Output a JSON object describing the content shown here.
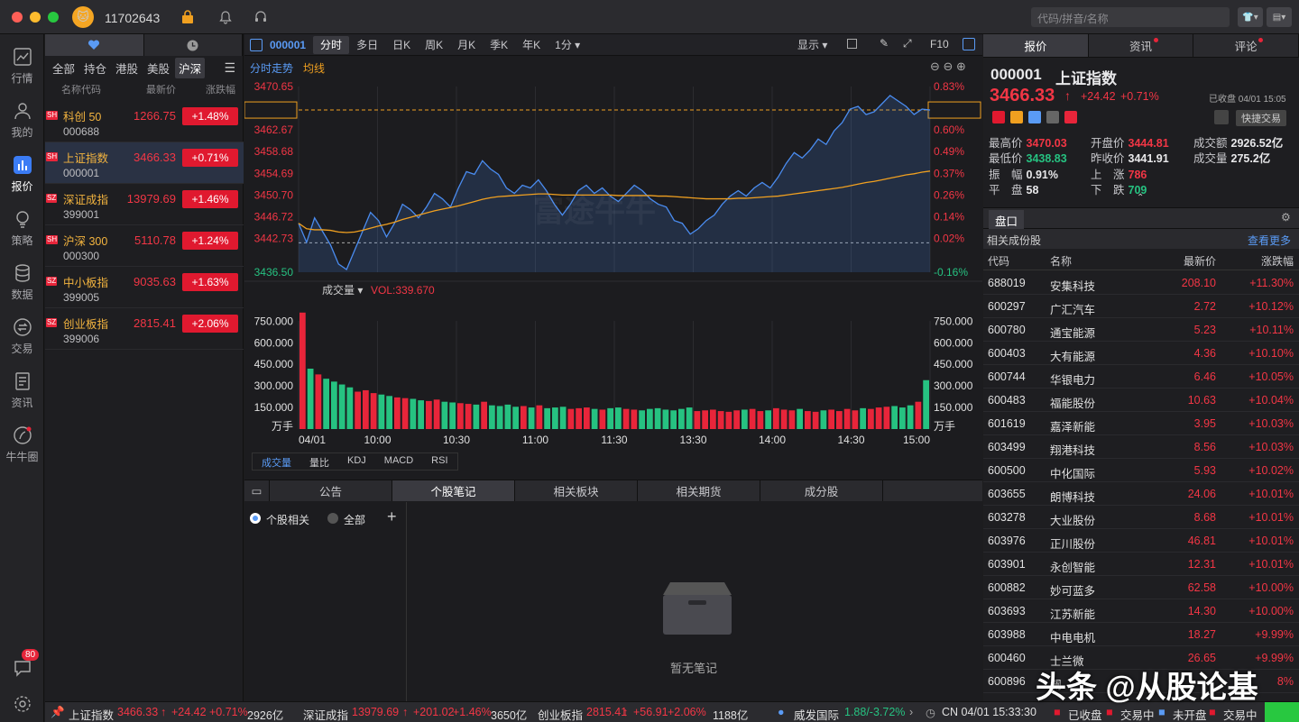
{
  "titlebar": {
    "user_id": "11702643",
    "search_placeholder": "代码/拼音/名称",
    "traffic_colors": [
      "#fe5f57",
      "#febc2e",
      "#28c840"
    ]
  },
  "sidebar": {
    "items": [
      {
        "label": "行情",
        "icon": "trend-chart-icon"
      },
      {
        "label": "我的",
        "icon": "user-icon"
      },
      {
        "label": "报价",
        "icon": "bar-chart-icon",
        "active": true
      },
      {
        "label": "策略",
        "icon": "bulb-icon"
      },
      {
        "label": "数据",
        "icon": "database-icon"
      },
      {
        "label": "交易",
        "icon": "exchange-icon"
      },
      {
        "label": "资讯",
        "icon": "document-icon"
      },
      {
        "label": "牛牛圈",
        "icon": "circle-icon"
      }
    ],
    "message_count": "80"
  },
  "watchlist": {
    "filters": [
      "全部",
      "持仓",
      "港股",
      "美股",
      "沪深"
    ],
    "active_filter": "沪深",
    "headers": {
      "name": "名称代码",
      "price": "最新价",
      "change": "涨跌幅"
    },
    "rows": [
      {
        "market": "SH",
        "name": "科创 50",
        "code": "000688",
        "price": "1266.75",
        "change": "+1.48%"
      },
      {
        "market": "SH",
        "name": "上证指数",
        "code": "000001",
        "price": "3466.33",
        "change": "+0.71%"
      },
      {
        "market": "SZ",
        "name": "深证成指",
        "code": "399001",
        "price": "13979.69",
        "change": "+1.46%"
      },
      {
        "market": "SH",
        "name": "沪深 300",
        "code": "000300",
        "price": "5110.78",
        "change": "+1.24%"
      },
      {
        "market": "SZ",
        "name": "中小板指",
        "code": "399005",
        "price": "9035.63",
        "change": "+1.63%"
      },
      {
        "market": "SZ",
        "name": "创业板指",
        "code": "399006",
        "price": "2815.41",
        "change": "+2.06%"
      }
    ]
  },
  "chart_toolbar": {
    "code": "000001",
    "periods": [
      "分时",
      "多日",
      "日K",
      "周K",
      "月K",
      "季K",
      "年K",
      "1分"
    ],
    "active_period": "分时",
    "display_label": "显示",
    "f10_label": "F10"
  },
  "chart_sub": {
    "trend_label": "分时走势",
    "avg_label": "均线",
    "watermark": "富途牛牛"
  },
  "volume_bar": {
    "label": "成交量",
    "value": "VOL:339.670"
  },
  "indicator_tabs": [
    "成交量",
    "量比",
    "KDJ",
    "MACD",
    "RSI"
  ],
  "bottom_tabs": [
    "公告",
    "个股笔记",
    "相关板块",
    "相关期货",
    "成分股"
  ],
  "active_bottom_tab": "个股笔记",
  "notes": {
    "radio_related": "个股相关",
    "radio_all": "全部",
    "empty_text": "暂无笔记"
  },
  "chart_data": [
    {
      "type": "line",
      "title": "分时走势",
      "x_ticks": [
        "04/01",
        "10:00",
        "10:30",
        "11:00",
        "11:30",
        "13:30",
        "14:00",
        "14:30",
        "15:00"
      ],
      "y_ticks_left": [
        "3470.65",
        "3466.33",
        "3462.67",
        "3458.68",
        "3454.69",
        "3450.70",
        "3446.72",
        "3442.73",
        "3436.50"
      ],
      "y_ticks_right": [
        "0.83%",
        "0.71%",
        "0.60%",
        "0.49%",
        "0.37%",
        "0.26%",
        "0.14%",
        "0.02%",
        "-0.16%"
      ],
      "ylim": [
        3436.5,
        3470.65
      ],
      "prev_close": 3441.91,
      "series": [
        {
          "name": "价格",
          "color": "#4a8cf0",
          "values": [
            3445.5,
            3442.0,
            3446.5,
            3444.0,
            3441.5,
            3438.0,
            3437.0,
            3440.5,
            3444.0,
            3447.5,
            3446.0,
            3443.0,
            3445.5,
            3449.0,
            3448.0,
            3446.5,
            3448.5,
            3451.0,
            3450.0,
            3448.5,
            3452.0,
            3455.0,
            3454.5,
            3457.0,
            3455.5,
            3454.5,
            3452.0,
            3451.0,
            3452.5,
            3452.0,
            3453.5,
            3451.5,
            3449.0,
            3447.0,
            3449.0,
            3451.5,
            3452.5,
            3451.0,
            3452.0,
            3450.5,
            3449.5,
            3451.0,
            3452.5,
            3451.5,
            3450.0,
            3449.0,
            3448.5,
            3446.0,
            3445.5,
            3443.5,
            3444.5,
            3446.0,
            3447.0,
            3449.0,
            3450.5,
            3451.5,
            3450.5,
            3452.0,
            3453.0,
            3452.0,
            3454.0,
            3456.5,
            3458.5,
            3457.5,
            3459.0,
            3461.0,
            3460.0,
            3462.5,
            3464.0,
            3466.5,
            3467.0,
            3465.5,
            3466.0,
            3467.5,
            3469.0,
            3468.0,
            3467.0,
            3465.5,
            3466.5,
            3466.33
          ]
        },
        {
          "name": "均线",
          "color": "#f0a020",
          "values": [
            3445.5,
            3444.5,
            3444.3,
            3444.3,
            3444.2,
            3443.9,
            3443.8,
            3443.9,
            3444.2,
            3444.6,
            3445.0,
            3445.3,
            3445.7,
            3446.2,
            3446.6,
            3447.0,
            3447.4,
            3447.8,
            3448.1,
            3448.4,
            3448.7,
            3449.1,
            3449.5,
            3449.9,
            3450.2,
            3450.4,
            3450.5,
            3450.6,
            3450.7,
            3450.8,
            3450.9,
            3450.9,
            3450.8,
            3450.7,
            3450.7,
            3450.7,
            3450.7,
            3450.7,
            3450.7,
            3450.7,
            3450.6,
            3450.6,
            3450.6,
            3450.6,
            3450.6,
            3450.5,
            3450.5,
            3450.4,
            3450.3,
            3450.2,
            3450.1,
            3450.0,
            3450.0,
            3450.0,
            3450.0,
            3450.1,
            3450.1,
            3450.2,
            3450.3,
            3450.4,
            3450.5,
            3450.7,
            3450.9,
            3451.1,
            3451.3,
            3451.5,
            3451.7,
            3451.9,
            3452.1,
            3452.4,
            3452.7,
            3453.0,
            3453.2,
            3453.5,
            3453.8,
            3454.1,
            3454.4,
            3454.6,
            3454.9,
            3455.1
          ]
        }
      ]
    },
    {
      "type": "bar",
      "title": "成交量",
      "ylabel": "万手",
      "y_ticks": [
        "750.000",
        "600.000",
        "450.000",
        "300.000",
        "150.000"
      ],
      "ylim": [
        0,
        840
      ],
      "values": [
        810,
        420,
        380,
        350,
        330,
        310,
        290,
        260,
        270,
        250,
        240,
        230,
        220,
        215,
        210,
        200,
        195,
        205,
        190,
        185,
        180,
        175,
        170,
        190,
        165,
        160,
        170,
        155,
        160,
        150,
        165,
        145,
        150,
        155,
        140,
        145,
        150,
        140,
        135,
        145,
        150,
        140,
        135,
        130,
        140,
        145,
        135,
        130,
        140,
        150,
        125,
        130,
        135,
        125,
        120,
        130,
        135,
        140,
        125,
        130,
        145,
        135,
        130,
        140,
        125,
        120,
        130,
        135,
        125,
        140,
        130,
        145,
        140,
        150,
        155,
        160,
        150,
        165,
        190,
        340
      ],
      "colors_up_down": [
        "#e8253a",
        "#26c281"
      ]
    }
  ],
  "quote": {
    "tabs": [
      "报价",
      "资讯",
      "评论"
    ],
    "code": "000001",
    "name": "上证指数",
    "price": "3466.33",
    "change": "+24.42",
    "change_pct": "+0.71%",
    "status": "已收盘 04/01 15:05",
    "quick_trade": "快捷交易",
    "stats": {
      "high_label": "最高价",
      "high": "3470.03",
      "open_label": "开盘价",
      "open": "3444.81",
      "turnover_label": "成交额",
      "turnover": "2926.52亿",
      "low_label": "最低价",
      "low": "3438.83",
      "prev_label": "昨收价",
      "prev": "3441.91",
      "volume_label": "成交量",
      "volume": "275.2亿",
      "amp_label": "振　幅",
      "amp": "0.91%",
      "up_label": "上　涨",
      "up": "786",
      "flat_label": "平　盘",
      "flat": "58",
      "down_label": "下　跌",
      "down": "709"
    },
    "panel_label": "盘口",
    "related_label": "相关成份股",
    "more_label": "查看更多",
    "table_headers": {
      "code": "代码",
      "name": "名称",
      "price": "最新价",
      "change": "涨跌幅"
    },
    "components": [
      {
        "code": "688019",
        "name": "安集科技",
        "price": "208.10",
        "change": "+11.30%"
      },
      {
        "code": "600297",
        "name": "广汇汽车",
        "price": "2.72",
        "change": "+10.12%"
      },
      {
        "code": "600780",
        "name": "通宝能源",
        "price": "5.23",
        "change": "+10.11%"
      },
      {
        "code": "600403",
        "name": "大有能源",
        "price": "4.36",
        "change": "+10.10%"
      },
      {
        "code": "600744",
        "name": "华银电力",
        "price": "6.46",
        "change": "+10.05%"
      },
      {
        "code": "600483",
        "name": "福能股份",
        "price": "10.63",
        "change": "+10.04%"
      },
      {
        "code": "601619",
        "name": "嘉泽新能",
        "price": "3.95",
        "change": "+10.03%"
      },
      {
        "code": "603499",
        "name": "翔港科技",
        "price": "8.56",
        "change": "+10.03%"
      },
      {
        "code": "600500",
        "name": "中化国际",
        "price": "5.93",
        "change": "+10.02%"
      },
      {
        "code": "603655",
        "name": "朗博科技",
        "price": "24.06",
        "change": "+10.01%"
      },
      {
        "code": "603278",
        "name": "大业股份",
        "price": "8.68",
        "change": "+10.01%"
      },
      {
        "code": "603976",
        "name": "正川股份",
        "price": "46.81",
        "change": "+10.01%"
      },
      {
        "code": "603901",
        "name": "永创智能",
        "price": "12.31",
        "change": "+10.01%"
      },
      {
        "code": "600882",
        "name": "妙可蓝多",
        "price": "62.58",
        "change": "+10.00%"
      },
      {
        "code": "603693",
        "name": "江苏新能",
        "price": "14.30",
        "change": "+10.00%"
      },
      {
        "code": "603988",
        "name": "中电电机",
        "price": "18.27",
        "change": "+9.99%"
      },
      {
        "code": "600460",
        "name": "士兰微",
        "price": "26.65",
        "change": "+9.99%"
      },
      {
        "code": "600896",
        "name": "澜",
        "price": "",
        "change": "8%"
      }
    ]
  },
  "statusbar": {
    "i1_name": "上证指数",
    "i1_price": "3466.33",
    "i1_chg": "+24.42",
    "i1_pct": "+0.71%",
    "i1_amt": "2926亿",
    "i2_name": "深证成指",
    "i2_price": "13979.69",
    "i2_chg": "+201.02",
    "i2_pct": "+1.46%",
    "i2_amt": "3650亿",
    "i3_name": "创业板指",
    "i3_price": "2815.41",
    "i3_chg": "+56.91",
    "i3_pct": "+2.06%",
    "i3_amt": "1188亿",
    "news_name": "威发国际",
    "news_val": "1.88/-3.72%",
    "time": "CN 04/01 15:33:30",
    "m1": "已收盘",
    "m2": "交易中",
    "m3": "未开盘",
    "m4": "交易中"
  },
  "watermark_text": "头条 @从股论基"
}
